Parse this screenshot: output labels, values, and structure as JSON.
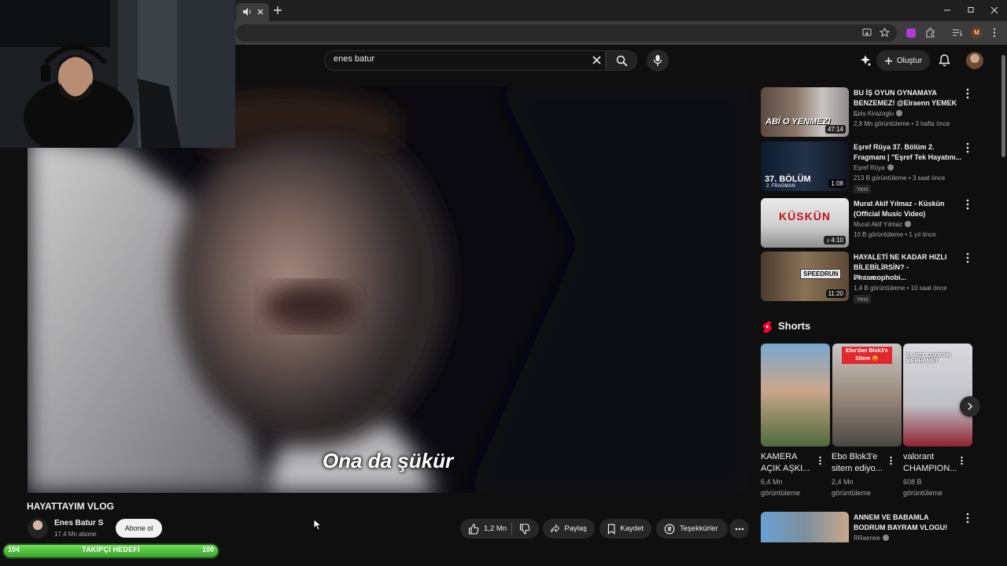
{
  "browser": {
    "tab_audio_icon": "speaker-icon",
    "window_controls": [
      "minimize",
      "restore",
      "close"
    ]
  },
  "header": {
    "search_value": "enes batur",
    "create_label": "Oluştur"
  },
  "video": {
    "subtitle": "Ona da şükür",
    "title": "HAYATTAYIM VLOG",
    "channel_name": "Enes Batur S",
    "subscribers": "17,4 Mn abone",
    "subscribe_label": "Abone ol",
    "likes": "1,2 Mn",
    "share_label": "Paylaş",
    "save_label": "Kaydet",
    "thanks_label": "Teşekkürler"
  },
  "follower_goal": {
    "current": "104",
    "label": "TAKİPÇİ HEDEFİ",
    "target": "100",
    "progress": 1.0
  },
  "recommendations": [
    {
      "title": "BU İŞ OYUN OYNAMAYA BENZEMEZ! @Elraenn YEMEK ...",
      "channel": "Enis Kirazoglu",
      "verified": true,
      "meta": "2,8 Mn görüntüleme • 3 hafta önce",
      "duration": "47:14",
      "thumb_text": "ABİ O YENMEZ!"
    },
    {
      "title": "Eşref Rüya 37. Bölüm 2. Fragmanı | \"Eşref Tek Hayatını...",
      "channel": "Eşref Rüya",
      "verified": true,
      "meta": "213 B görüntüleme • 3 saat önce",
      "badge": "Yeni",
      "duration": "1:08",
      "thumb_text": "37. BÖLÜM",
      "thumb_sub": "2. FRAGMAN"
    },
    {
      "title": "Murat Akif Yılmaz - Küskün (Official Music Video)",
      "channel": "Murat Akif Yılmaz",
      "verified": true,
      "meta": "10 B görüntüleme • 1 yıl önce",
      "duration": "4:10",
      "thumb_text": "KÜSKÜN"
    },
    {
      "title": "HAYALETİ NE KADAR HIZLI BİLEBİLİRSİN? - Phasmophobi...",
      "channel": "Verdant",
      "verified": false,
      "meta": "1,4 B görüntüleme • 10 saat önce",
      "badge": "Yeni",
      "duration": "11:20",
      "thumb_text": "SPEEDRUN"
    },
    {
      "title": "ANNEM VE BABAMLA BODRUM BAYRAM VLOGU!",
      "channel": "RRaenee",
      "verified": true
    }
  ],
  "shorts": {
    "title": "Shorts",
    "items": [
      {
        "title": "KAMERA AÇIK AŞKI...",
        "views": "6,4 Mn görüntüleme"
      },
      {
        "title": "Ebo Blok3'e sitem ediyo...",
        "views": "2,4 Mn görüntüleme",
        "overlay": "Ebo'dan Blok3'e Sitem 😡"
      },
      {
        "title": "valorant CHAMPION...",
        "views": "608 B görüntüleme",
        "overlay": "2+ VCT LOCK//IN MERHAMET"
      }
    ]
  },
  "colors": {
    "background": "#0f0f0f",
    "youtube_red": "#ff0033",
    "progress_green": "#5fcf45"
  }
}
